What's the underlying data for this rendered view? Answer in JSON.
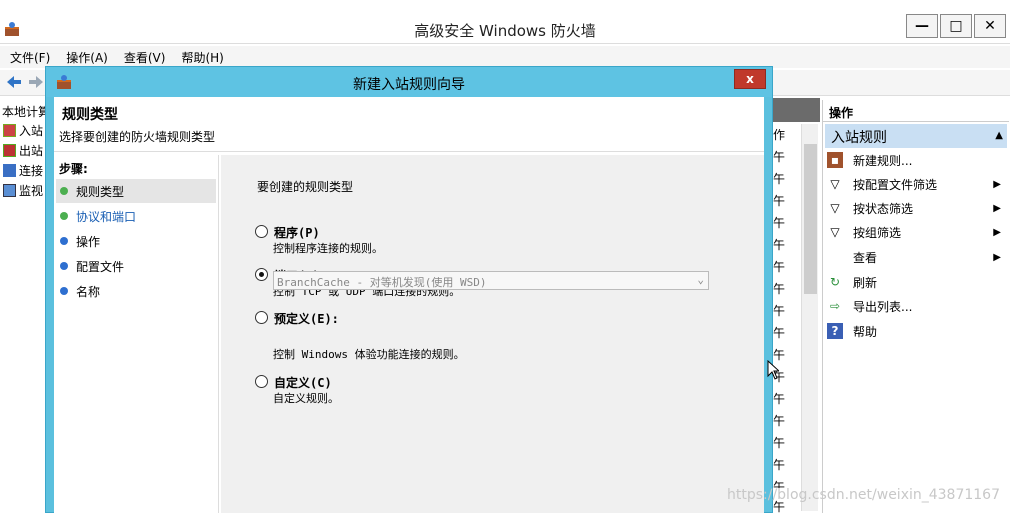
{
  "window": {
    "title": "高级安全 Windows 防火墙",
    "minimize_label": "—",
    "maximize_label": "□",
    "close_label": "✕"
  },
  "menu": {
    "file": "文件(F)",
    "action": "操作(A)",
    "view": "查看(V)",
    "help": "帮助(H)"
  },
  "tree": {
    "root": "本地计算",
    "items": [
      "入站",
      "出站",
      "连接",
      "监视"
    ]
  },
  "middle_rows": [
    "作",
    "午",
    "午",
    "午",
    "午",
    "午",
    "午",
    "午",
    "午",
    "午",
    "午",
    "午",
    "午",
    "午",
    "午",
    "午",
    "午",
    "午"
  ],
  "right_panel": {
    "header": "操作",
    "section": "入站规则",
    "actions": [
      {
        "label": "新建规则...",
        "icon": "new-rule-icon"
      },
      {
        "label": "按配置文件筛选",
        "icon": "filter-icon",
        "submenu": true
      },
      {
        "label": "按状态筛选",
        "icon": "filter-icon",
        "submenu": true
      },
      {
        "label": "按组筛选",
        "icon": "filter-icon",
        "submenu": true
      },
      {
        "label": "查看",
        "icon": "",
        "submenu": true
      },
      {
        "label": "刷新",
        "icon": "refresh-icon"
      },
      {
        "label": "导出列表...",
        "icon": "export-icon"
      },
      {
        "label": "帮助",
        "icon": "help-icon"
      }
    ]
  },
  "dialog": {
    "title": "新建入站规则向导",
    "close_label": "x",
    "header_title": "规则类型",
    "header_subtitle": "选择要创建的防火墙规则类型",
    "steps_title": "步骤:",
    "steps": [
      {
        "label": "规则类型",
        "state": "active",
        "dot_color": "#4caf50"
      },
      {
        "label": "协议和端口",
        "state": "link",
        "dot_color": "#4caf50"
      },
      {
        "label": "操作",
        "state": "normal",
        "dot_color": "#2e6fd0"
      },
      {
        "label": "配置文件",
        "state": "normal",
        "dot_color": "#2e6fd0"
      },
      {
        "label": "名称",
        "state": "normal",
        "dot_color": "#2e6fd0"
      }
    ],
    "question": "要创建的规则类型",
    "options": [
      {
        "title": "程序(P)",
        "desc": "控制程序连接的规则。",
        "selected": false
      },
      {
        "title": "端口(O)",
        "desc": "控制 TCP 或 UDP 端口连接的规则。",
        "selected": true
      },
      {
        "title": "预定义(E):",
        "desc": "控制 Windows 体验功能连接的规则。",
        "selected": false
      },
      {
        "title": "自定义(C)",
        "desc": "自定义规则。",
        "selected": false
      }
    ],
    "predefined_select_value": "BranchCache - 对等机发现(使用 WSD)"
  },
  "watermark": "https://blog.csdn.net/weixin_43871167"
}
